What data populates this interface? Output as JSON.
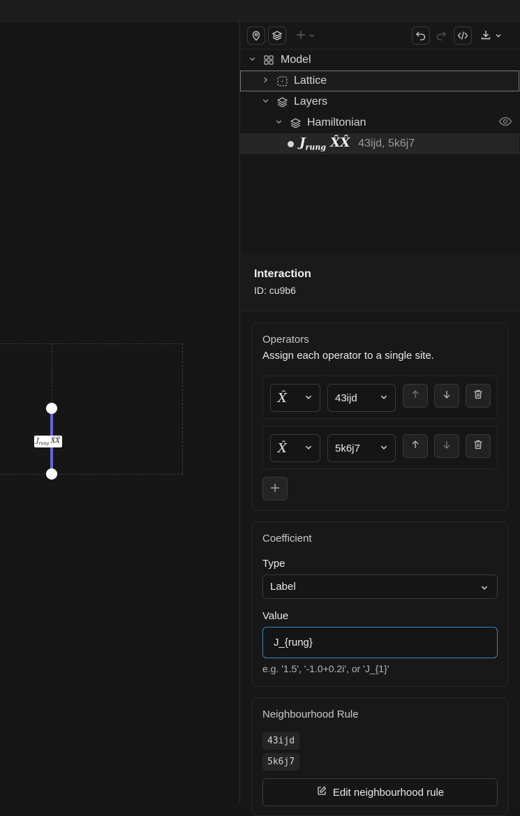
{
  "toolbar": {
    "icons": [
      "map-pin-icon",
      "layers-icon",
      "plus-icon",
      "chevron-down-icon",
      "undo-icon",
      "redo-icon",
      "code-icon",
      "download-icon",
      "chevron-down-icon"
    ]
  },
  "tree": {
    "model_label": "Model",
    "lattice_label": "Lattice",
    "layers_label": "Layers",
    "hamiltonian_label": "Hamiltonian",
    "interaction": {
      "symbol": "J",
      "subscript": "rung",
      "operators": "X̂X̂",
      "sites": "43ijd, 5k6j7"
    }
  },
  "canvas": {
    "bond_label_symbol": "J",
    "bond_label_subscript": "rung",
    "bond_label_ops": "X̂X̂",
    "bond_color": "#6464d8"
  },
  "inspector": {
    "title": "Interaction",
    "id_text": "ID: cu9b6",
    "operators_card": {
      "title": "Operators",
      "description": "Assign each operator to a single site.",
      "rows": [
        {
          "operator": "X̂",
          "site": "43ijd"
        },
        {
          "operator": "X̂",
          "site": "5k6j7"
        }
      ]
    },
    "coefficient_card": {
      "title": "Coefficient",
      "type_label": "Type",
      "type_value": "Label",
      "value_label": "Value",
      "value": "J_{rung}",
      "hint": "e.g. '1.5', '-1.0+0.2i', or 'J_{1}'"
    },
    "neighbourhood_card": {
      "title": "Neighbourhood Rule",
      "sites": [
        "43ijd",
        "5k6j7"
      ],
      "edit_label": "Edit neighbourhood rule"
    }
  },
  "colors": {
    "accent_focus": "#3b87c9",
    "bond": "#6464d8"
  }
}
